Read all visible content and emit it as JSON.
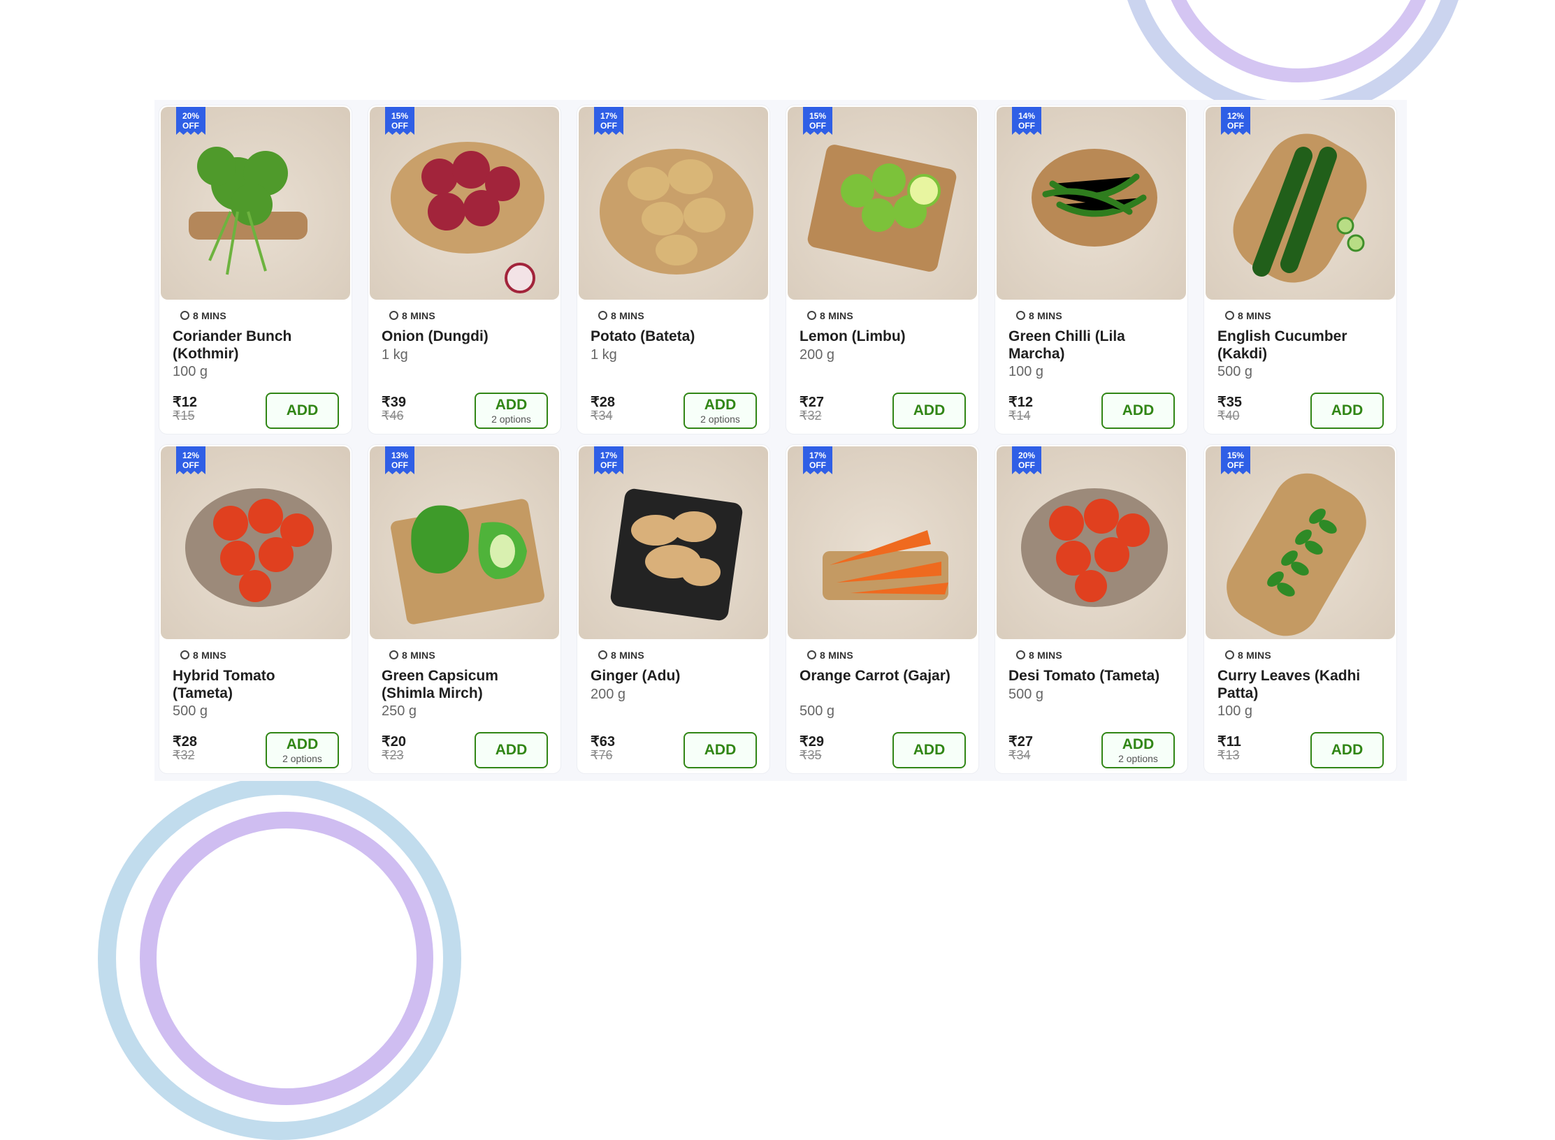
{
  "colors": {
    "accent": "#318616",
    "badge": "#2f5fe6"
  },
  "products": [
    {
      "discount_pct": "20%",
      "discount_off": "OFF",
      "eta": "8 MINS",
      "name": "Coriander Bunch (Kothmir)",
      "qty": "100 g",
      "price": "₹12",
      "mrp": "₹15",
      "add": "ADD",
      "options": "",
      "icon": "coriander-image"
    },
    {
      "discount_pct": "15%",
      "discount_off": "OFF",
      "eta": "8 MINS",
      "name": "Onion (Dungdi)",
      "qty": "1 kg",
      "price": "₹39",
      "mrp": "₹46",
      "add": "ADD",
      "options": "2 options",
      "icon": "onion-image"
    },
    {
      "discount_pct": "17%",
      "discount_off": "OFF",
      "eta": "8 MINS",
      "name": "Potato (Bateta)",
      "qty": "1 kg",
      "price": "₹28",
      "mrp": "₹34",
      "add": "ADD",
      "options": "2 options",
      "icon": "potato-image"
    },
    {
      "discount_pct": "15%",
      "discount_off": "OFF",
      "eta": "8 MINS",
      "name": "Lemon (Limbu)",
      "qty": "200 g",
      "price": "₹27",
      "mrp": "₹32",
      "add": "ADD",
      "options": "",
      "icon": "lemon-image"
    },
    {
      "discount_pct": "14%",
      "discount_off": "OFF",
      "eta": "8 MINS",
      "name": "Green Chilli (Lila Marcha)",
      "qty": "100 g",
      "price": "₹12",
      "mrp": "₹14",
      "add": "ADD",
      "options": "",
      "icon": "chilli-image"
    },
    {
      "discount_pct": "12%",
      "discount_off": "OFF",
      "eta": "8 MINS",
      "name": "English Cucumber (Kakdi)",
      "qty": "500 g",
      "price": "₹35",
      "mrp": "₹40",
      "add": "ADD",
      "options": "",
      "icon": "cucumber-image"
    },
    {
      "discount_pct": "12%",
      "discount_off": "OFF",
      "eta": "8 MINS",
      "name": "Hybrid Tomato (Tameta)",
      "qty": "500 g",
      "price": "₹28",
      "mrp": "₹32",
      "add": "ADD",
      "options": "2 options",
      "icon": "tomato-image"
    },
    {
      "discount_pct": "13%",
      "discount_off": "OFF",
      "eta": "8 MINS",
      "name": "Green Capsicum (Shimla Mirch)",
      "qty": "250 g",
      "price": "₹20",
      "mrp": "₹23",
      "add": "ADD",
      "options": "",
      "icon": "capsicum-image"
    },
    {
      "discount_pct": "17%",
      "discount_off": "OFF",
      "eta": "8 MINS",
      "name": "Ginger (Adu)",
      "qty": "200 g",
      "price": "₹63",
      "mrp": "₹76",
      "add": "ADD",
      "options": "",
      "icon": "ginger-image"
    },
    {
      "discount_pct": "17%",
      "discount_off": "OFF",
      "eta": "8 MINS",
      "name": "Orange Carrot (Gajar)",
      "qty": "500 g",
      "price": "₹29",
      "mrp": "₹35",
      "add": "ADD",
      "options": "",
      "icon": "carrot-image"
    },
    {
      "discount_pct": "20%",
      "discount_off": "OFF",
      "eta": "8 MINS",
      "name": "Desi Tomato (Tameta)",
      "qty": "500 g",
      "price": "₹27",
      "mrp": "₹34",
      "add": "ADD",
      "options": "2 options",
      "icon": "tomato-image"
    },
    {
      "discount_pct": "15%",
      "discount_off": "OFF",
      "eta": "8 MINS",
      "name": "Curry Leaves (Kadhi Patta)",
      "qty": "100 g",
      "price": "₹11",
      "mrp": "₹13",
      "add": "ADD",
      "options": "",
      "icon": "curry-leaves-image"
    }
  ]
}
